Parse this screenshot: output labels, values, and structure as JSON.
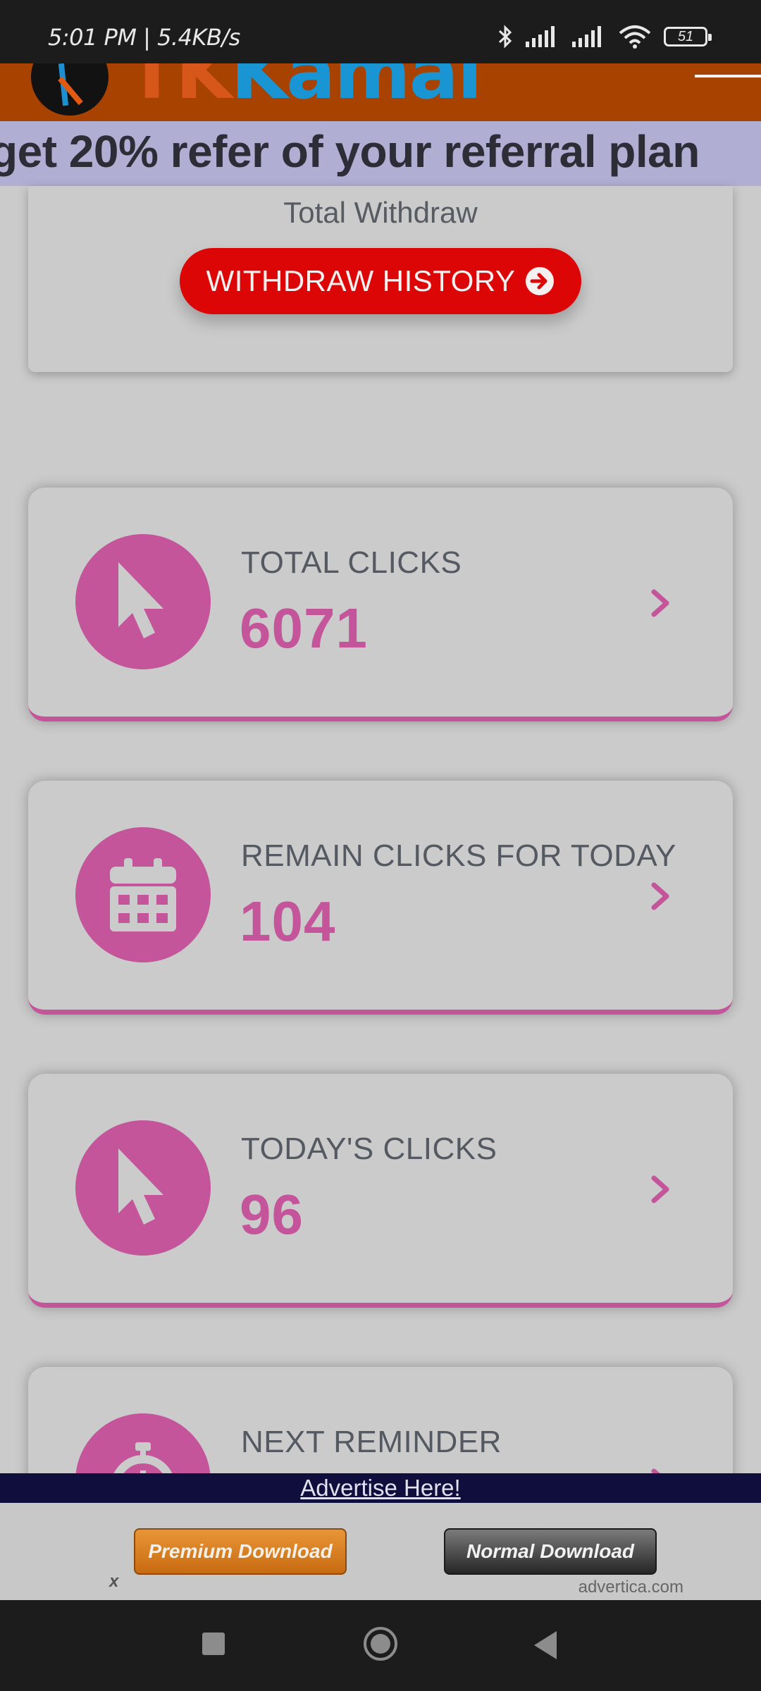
{
  "status_bar": {
    "time": "5:01 PM | 5.4KB/s",
    "battery": "51",
    "icons": [
      "bluetooth-icon",
      "signal-icon",
      "signal-icon",
      "wifi-icon",
      "battery-icon"
    ]
  },
  "header": {
    "logo_text_a": "TK",
    "logo_text_b": "Kamal",
    "menu_icon": "hamburger-icon"
  },
  "marquee": {
    "text": "get 20% refer of your referral plan"
  },
  "withdraw": {
    "label": "Total Withdraw",
    "button_label": "WITHDRAW HISTORY",
    "button_icon": "arrow-circle-right-icon"
  },
  "stats": [
    {
      "title": "TOTAL CLICKS",
      "value": "6071",
      "icon": "cursor-icon"
    },
    {
      "title": "REMAIN CLICKS FOR TODAY",
      "value": "104",
      "icon": "calendar-icon"
    },
    {
      "title": "TODAY'S CLICKS",
      "value": "96",
      "icon": "cursor-icon"
    },
    {
      "title": "NEXT REMINDER",
      "value": "",
      "icon": "stopwatch-icon"
    }
  ],
  "ad": {
    "advertise_link": "Advertise Here!",
    "premium_label": "Premium Download",
    "normal_label": "Normal Download",
    "domain": "advertica.com",
    "close_label": "x"
  },
  "colors": {
    "header_bg": "#a84200",
    "accent": "#c4559b",
    "withdraw_button": "#dc0606",
    "marquee_bg": "#b0aed2",
    "ad_strip": "#0f0e3c"
  }
}
